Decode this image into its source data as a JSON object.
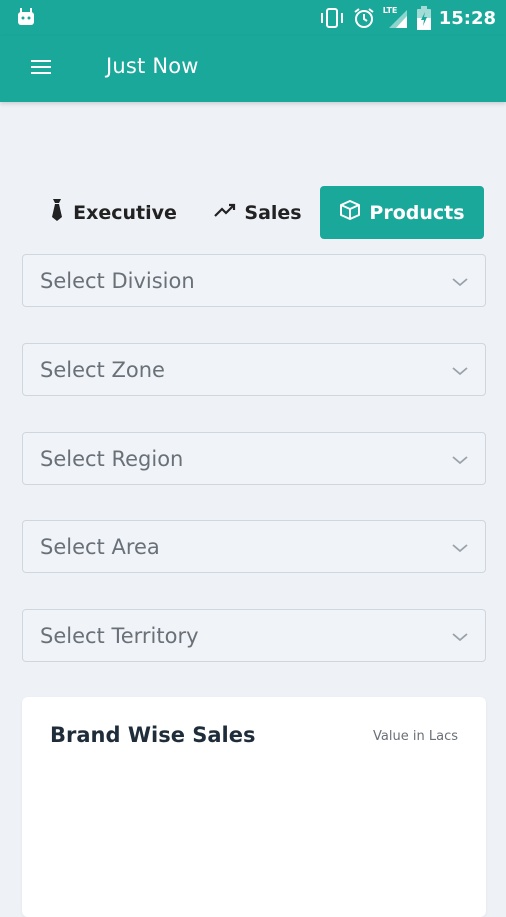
{
  "status_bar": {
    "time": "15:28",
    "network": "LTE"
  },
  "app_bar": {
    "title": "Just Now",
    "menu_icon": "hamburger-icon"
  },
  "tabs": [
    {
      "label": "Executive",
      "icon": "tie-icon",
      "active": false
    },
    {
      "label": "Sales",
      "icon": "trend-up-icon",
      "active": false
    },
    {
      "label": "Products",
      "icon": "cube-icon",
      "active": true
    }
  ],
  "filters": [
    {
      "placeholder": "Select Division"
    },
    {
      "placeholder": "Select Zone"
    },
    {
      "placeholder": "Select Region"
    },
    {
      "placeholder": "Select Area"
    },
    {
      "placeholder": "Select Territory"
    }
  ],
  "card": {
    "title": "Brand Wise Sales",
    "note": "Value in Lacs"
  },
  "colors": {
    "primary": "#1aa89a",
    "background": "#eef2f7",
    "text_dark": "#1f2d3a",
    "placeholder": "#6a7078"
  }
}
